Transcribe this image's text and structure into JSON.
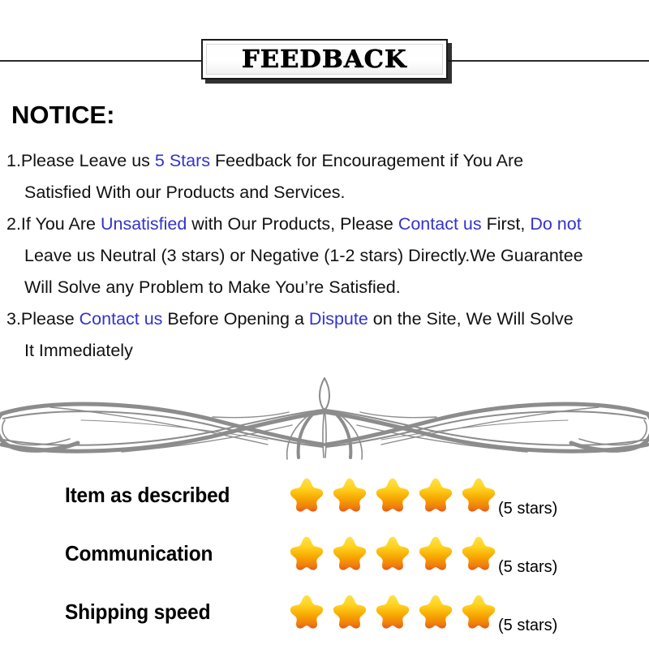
{
  "header": {
    "banner_title": "FEEDBACK"
  },
  "notice": {
    "heading": "NOTICE:",
    "items": [
      {
        "lines": [
          [
            {
              "t": "1.Please Leave us  ",
              "c": "black"
            },
            {
              "t": "5 Stars",
              "c": "blue"
            },
            {
              "t": "  Feedback for  Encouragement  if You Are",
              "c": "black"
            }
          ],
          [
            {
              "t": "Satisfied With our Products and Services.",
              "c": "black"
            }
          ]
        ]
      },
      {
        "lines": [
          [
            {
              "t": "2.If You Are ",
              "c": "black"
            },
            {
              "t": "Unsatisfied",
              "c": "blue"
            },
            {
              "t": " with Our Products, Please ",
              "c": "black"
            },
            {
              "t": "Contact us",
              "c": "blue"
            },
            {
              "t": " First, ",
              "c": "black"
            },
            {
              "t": "Do not",
              "c": "blue"
            }
          ],
          [
            {
              "t": "Leave us Neutral (3 stars) or Negative (1-2 stars) Directly.We Guarantee",
              "c": "black"
            }
          ],
          [
            {
              "t": "Will Solve any Problem to Make You’re  Satisfied.",
              "c": "black"
            }
          ]
        ]
      },
      {
        "lines": [
          [
            {
              "t": "3.Please ",
              "c": "black"
            },
            {
              "t": "Contact us",
              "c": "blue"
            },
            {
              "t": " Before Opening a ",
              "c": "black"
            },
            {
              "t": "Dispute",
              "c": "blue"
            },
            {
              "t": " on the Site, We Will Solve",
              "c": "black"
            }
          ],
          [
            {
              "t": "It Immediately",
              "c": "black"
            }
          ]
        ]
      }
    ]
  },
  "ratings": {
    "rows": [
      {
        "label": "Item as described",
        "stars": 5,
        "count_label": "(5 stars)"
      },
      {
        "label": "Communication",
        "stars": 5,
        "count_label": "(5 stars)"
      },
      {
        "label": "Shipping speed",
        "stars": 5,
        "count_label": "(5 stars)"
      }
    ]
  },
  "colors": {
    "blue_text": "#3333cc",
    "star_top": "#ffd93b",
    "star_mid": "#f7a900",
    "star_bottom": "#e2621b",
    "ornament": "#8c8c8c",
    "rule": "#2b2b2b"
  }
}
